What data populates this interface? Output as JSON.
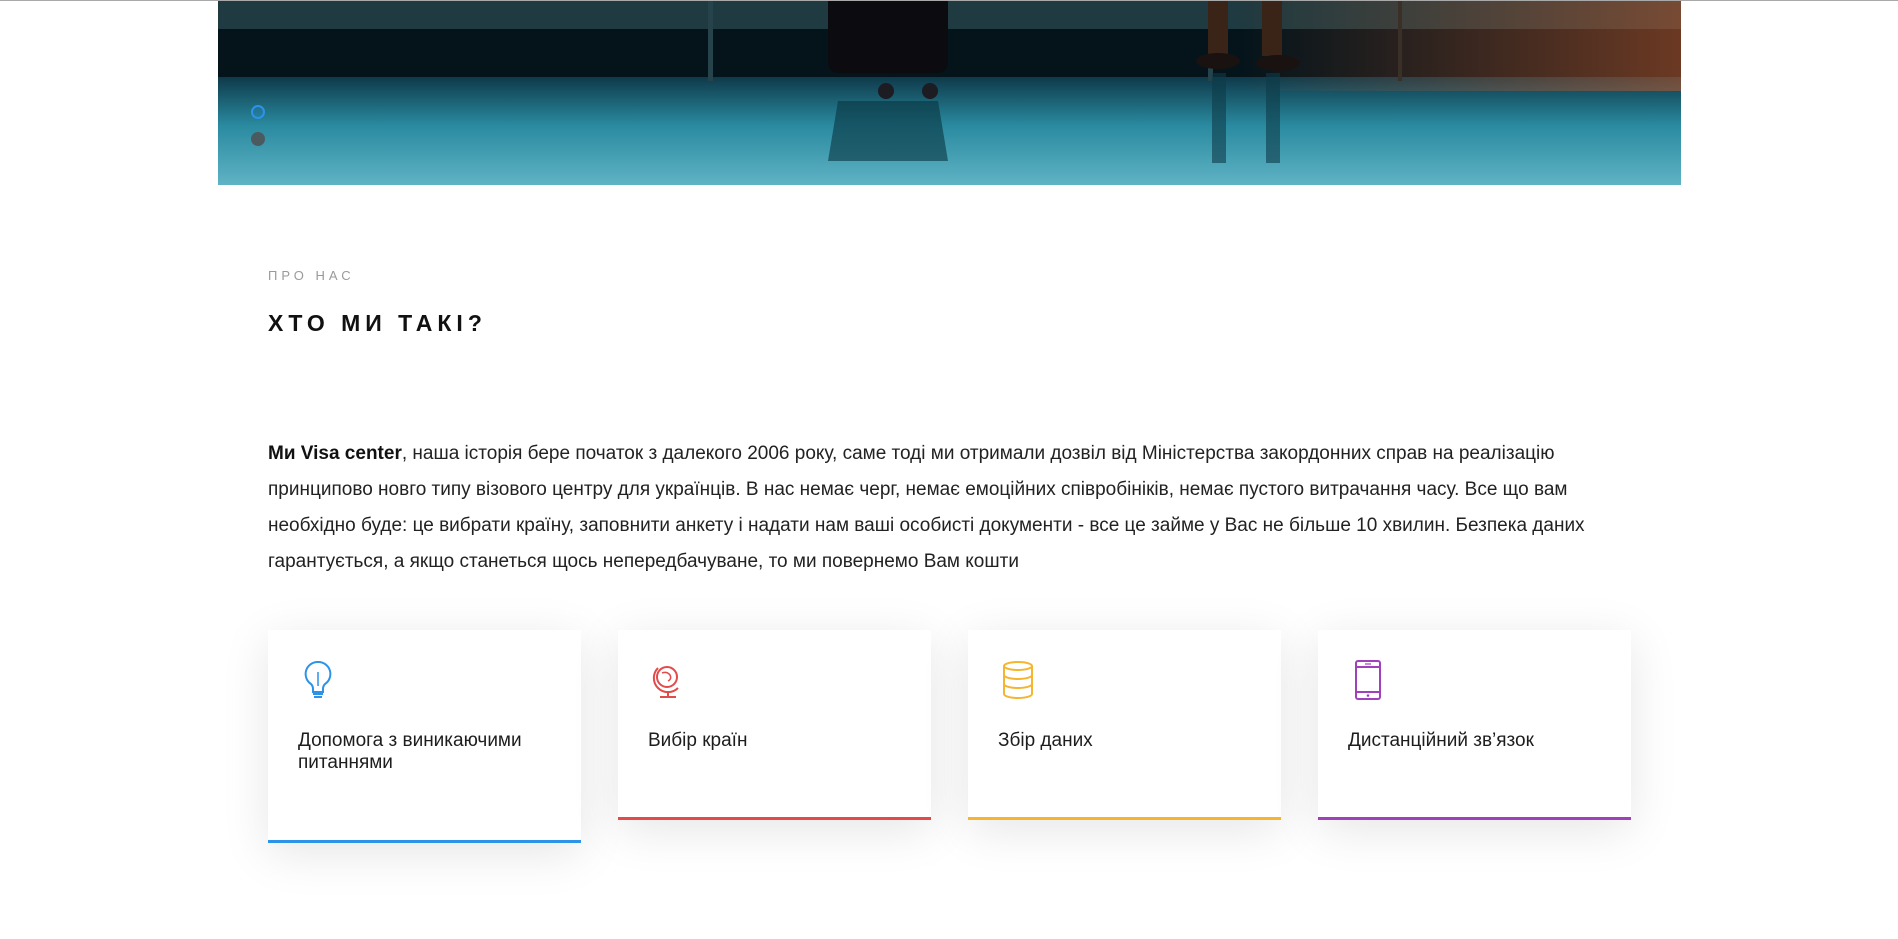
{
  "slider": {
    "dots": [
      "active",
      "inactive"
    ]
  },
  "about": {
    "kicker": "ПРО НАС",
    "title": "ХТО МИ ТАКІ?",
    "text_strong": "Ми Visa center",
    "text_rest": ", наша історія бере початок з далекого 2006 року, саме тоді ми отримали дозвіл від Міністерства закордонних справ на реалізацію принципово новго типу візового центру для українців. В нас немає черг, немає емоційних співробініків, немає пустого витрачання часу. Все що вам необхідно буде: це вибрати країну, заповнити анкету і надати нам ваші особисті документи - все це займе у Вас не більше 10 хвилин. Безпека даних гарантується, а якщо станеться щось непередбачуване, то ми повернемо Вам кошти"
  },
  "features": [
    {
      "label": "Допомога з виникаючими питаннями",
      "icon": "lightbulb-icon",
      "color": "#2c93e8"
    },
    {
      "label": "Вибір країн",
      "icon": "globe-icon",
      "color": "#e34a4a"
    },
    {
      "label": "Збір даних",
      "icon": "database-icon",
      "color": "#f5b52e"
    },
    {
      "label": "Дистанційний зв’язок",
      "icon": "tablet-icon",
      "color": "#a23fbd"
    }
  ]
}
